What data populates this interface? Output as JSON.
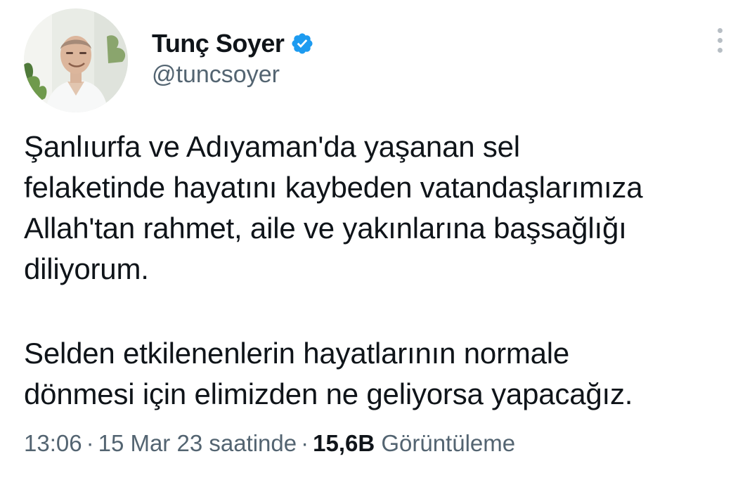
{
  "tweet": {
    "author": {
      "display_name": "Tunç Soyer",
      "handle": "@tuncsoyer",
      "verified": true
    },
    "text": {
      "paragraph1": [
        "Şanlıurfa ve Adıyaman'da yaşanan sel",
        "felaketinde hayatını kaybeden vatandaşlarımıza",
        "Allah'tan rahmet, aile ve yakınlarına başsağlığı",
        "diliyorum."
      ],
      "paragraph2": [
        "Selden etkilenenlerin hayatlarının normale",
        "dönmesi için elimizden ne geliyorsa yapacağız."
      ]
    },
    "meta": {
      "time": "13:06",
      "separator": "·",
      "date": "15 Mar 23 saatinde",
      "views_count": "15,6B",
      "views_label": "Görüntüleme"
    }
  },
  "icons": {
    "verified": "verified-badge-icon",
    "more": "more-vertical-icon"
  },
  "colors": {
    "text_primary": "#0f1419",
    "text_secondary": "#536471",
    "verified_blue": "#1d9bf0",
    "more_dots": "#b7bec4"
  }
}
